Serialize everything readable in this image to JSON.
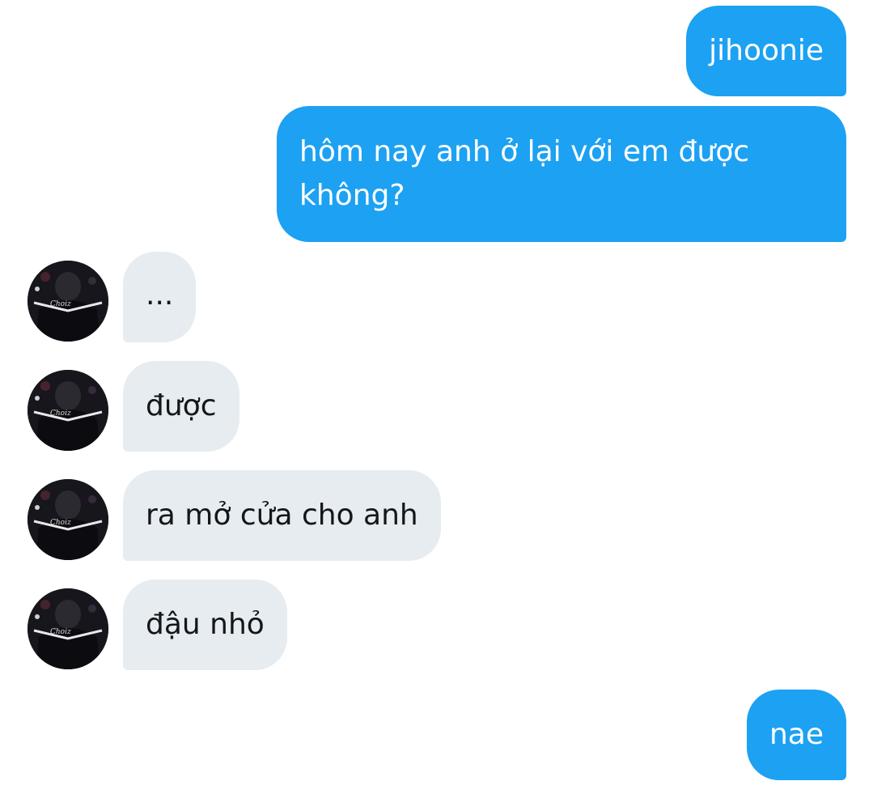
{
  "conversation": {
    "messages": [
      {
        "sender": "me",
        "text": "jihoonie"
      },
      {
        "sender": "me",
        "text": "hôm nay anh ở lại với em được không?"
      },
      {
        "sender": "other",
        "text": "..."
      },
      {
        "sender": "other",
        "text": "được"
      },
      {
        "sender": "other",
        "text": "ra mở cửa cho anh"
      },
      {
        "sender": "other",
        "text": "đậu nhỏ"
      },
      {
        "sender": "me",
        "text": "nae"
      }
    ]
  },
  "colors": {
    "sent_bubble": "#1da1f2",
    "received_bubble": "#e6ecf0",
    "received_text": "#14171a"
  },
  "avatar": {
    "icon": "profile-photo-avatar"
  }
}
